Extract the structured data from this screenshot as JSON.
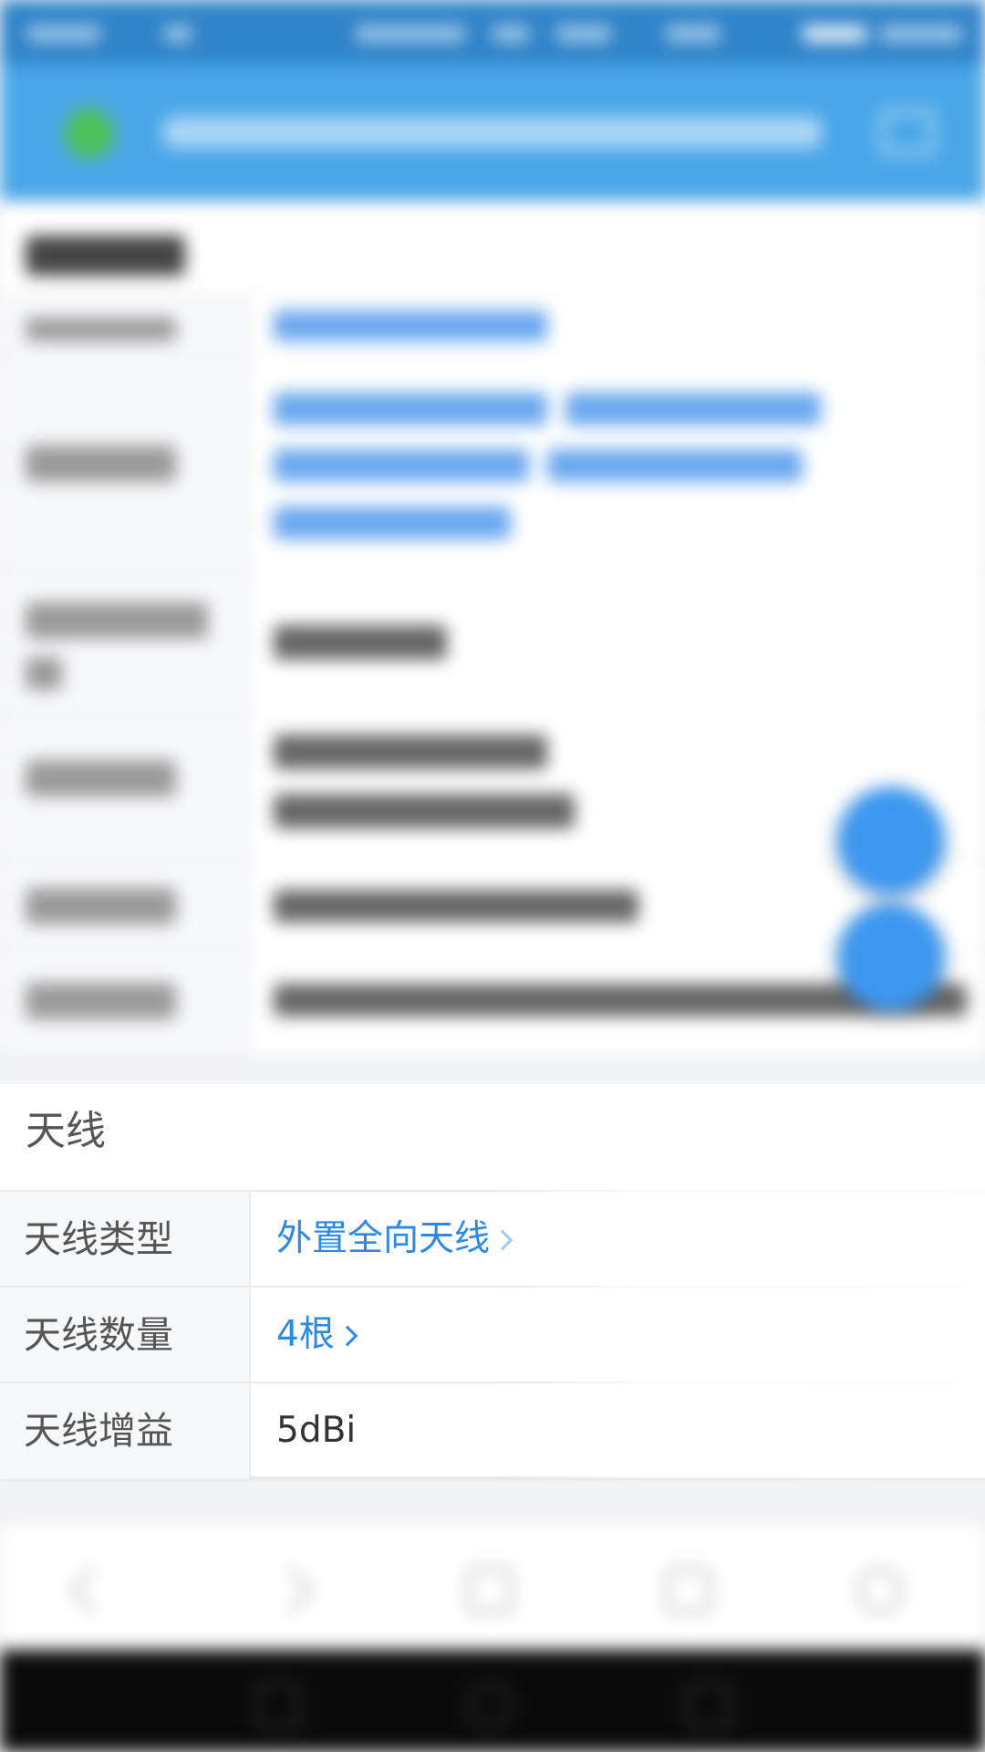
{
  "antenna": {
    "title": "天线",
    "rows": [
      {
        "label": "天线类型",
        "value": "外置全向天线"
      },
      {
        "label": "天线数量",
        "value": "4根"
      },
      {
        "label": "天线增益",
        "value": "5dBi"
      }
    ]
  },
  "colors": {
    "header": "#4aa6e8",
    "link": "#2c8ae6",
    "fab": "#3d97ef",
    "nav_bar": "#0a0a0a"
  },
  "icons": [
    "app-logo-icon",
    "menu-icon",
    "back-icon",
    "forward-icon",
    "home-icon",
    "tabs-icon",
    "more-icon",
    "nav-back-icon",
    "nav-home-icon",
    "nav-recent-icon"
  ]
}
